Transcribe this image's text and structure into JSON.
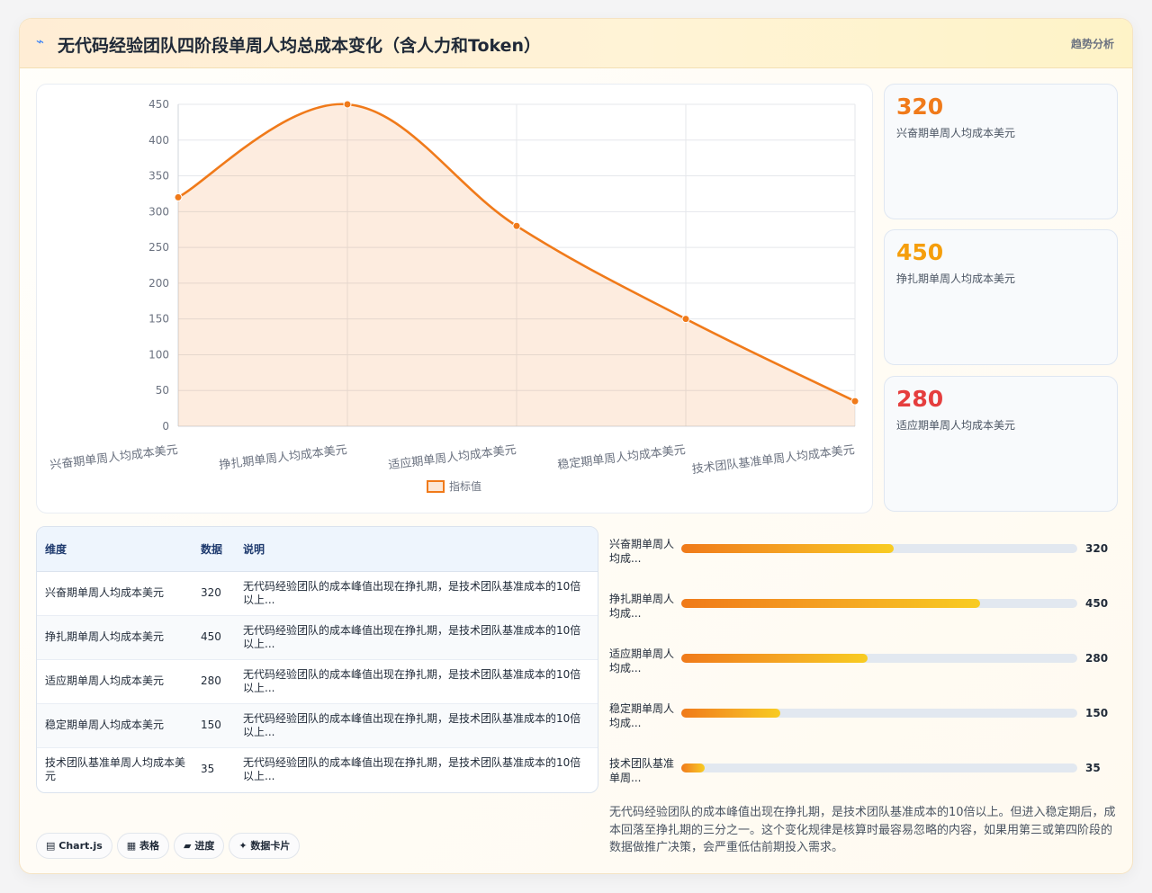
{
  "header": {
    "icon": "bolt-icon",
    "title": "无代码经验团队四阶段单周人均总成本变化（含人力和Token）",
    "analysis_label": "趋势分析"
  },
  "chart_data": {
    "type": "line",
    "categories": [
      "兴奋期单周人均成本美元",
      "挣扎期单周人均成本美元",
      "适应期单周人均成本美元",
      "稳定期单周人均成本美元",
      "技术团队基准单周人均成本美元"
    ],
    "series": [
      {
        "name": "指标值",
        "values": [
          320,
          450,
          280,
          150,
          35
        ],
        "color": "#f07a1a",
        "fill": "area"
      }
    ],
    "ylim": [
      0,
      450
    ],
    "yticks": [
      0,
      50,
      100,
      150,
      200,
      250,
      300,
      350,
      400,
      450
    ],
    "grid": true,
    "legend": "bottom",
    "smooth": true
  },
  "kpis": [
    {
      "value": "320",
      "label": "兴奋期单周人均成本美元",
      "color": "#f07a1a"
    },
    {
      "value": "450",
      "label": "挣扎期单周人均成本美元",
      "color": "#f59e0b"
    },
    {
      "value": "280",
      "label": "适应期单周人均成本美元",
      "color": "#e53e3e"
    }
  ],
  "table": {
    "headers": {
      "dim": "维度",
      "num": "数据",
      "desc": "说明"
    },
    "rows": [
      {
        "dim": "兴奋期单周人均成本美元",
        "num": "320",
        "desc": "无代码经验团队的成本峰值出现在挣扎期，是技术团队基准成本的10倍以上..."
      },
      {
        "dim": "挣扎期单周人均成本美元",
        "num": "450",
        "desc": "无代码经验团队的成本峰值出现在挣扎期，是技术团队基准成本的10倍以上..."
      },
      {
        "dim": "适应期单周人均成本美元",
        "num": "280",
        "desc": "无代码经验团队的成本峰值出现在挣扎期，是技术团队基准成本的10倍以上..."
      },
      {
        "dim": "稳定期单周人均成本美元",
        "num": "150",
        "desc": "无代码经验团队的成本峰值出现在挣扎期，是技术团队基准成本的10倍以上..."
      },
      {
        "dim": "技术团队基准单周人均成本美元",
        "num": "35",
        "desc": "无代码经验团队的成本峰值出现在挣扎期，是技术团队基准成本的10倍以上..."
      }
    ]
  },
  "progress": {
    "max": 450,
    "items": [
      {
        "label": "兴奋期单周人均成...",
        "value": "320",
        "fraction": 0.5367
      },
      {
        "label": "挣扎期单周人均成...",
        "value": "450",
        "fraction": 0.7555
      },
      {
        "label": "适应期单周人均成...",
        "value": "280",
        "fraction": 0.4695
      },
      {
        "label": "稳定期单周人均成...",
        "value": "150",
        "fraction": 0.25
      },
      {
        "label": "技术团队基准单周...",
        "value": "35",
        "fraction": 0.0585
      }
    ]
  },
  "summary": "无代码经验团队的成本峰值出现在挣扎期，是技术团队基准成本的10倍以上。但进入稳定期后，成本回落至挣扎期的三分之一。这个变化规律是核算时最容易忽略的内容，如果用第三或第四阶段的数据做推广决策，会严重低估前期投入需求。",
  "tags": [
    {
      "icon": "chart-icon",
      "glyph": "▤",
      "label": "Chart.js"
    },
    {
      "icon": "table-icon",
      "glyph": "▦",
      "label": "表格"
    },
    {
      "icon": "progress-icon",
      "glyph": "▰",
      "label": "进度"
    },
    {
      "icon": "sparkle-icon",
      "glyph": "✦",
      "label": "数据卡片"
    }
  ]
}
